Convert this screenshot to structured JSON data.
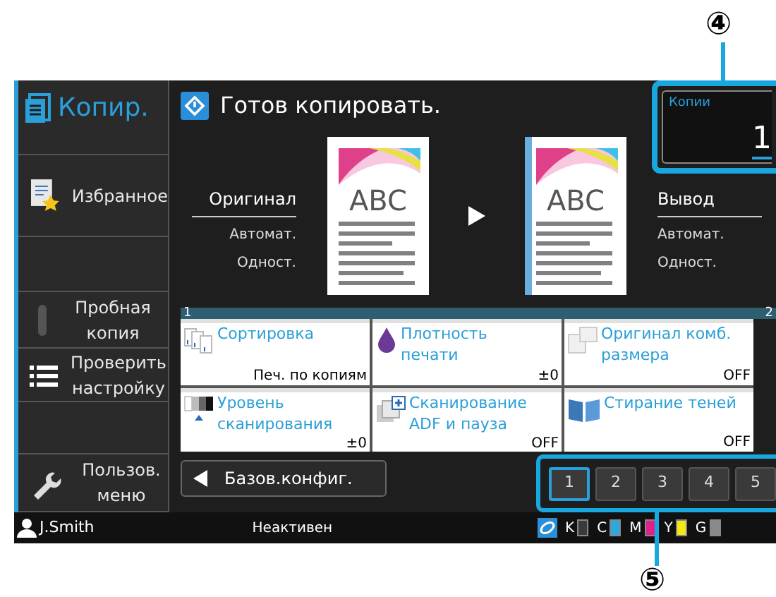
{
  "callouts": [
    {
      "number": "④"
    },
    {
      "number": "⑤"
    }
  ],
  "sidebar": {
    "items": [
      {
        "kind": "mode",
        "label": "Копир.",
        "selected": true
      },
      {
        "kind": "favorites",
        "label": "Избранное",
        "selected": false
      },
      {
        "kind": "blank"
      },
      {
        "kind": "toggle",
        "label": "Пробная копия",
        "on": false
      },
      {
        "kind": "check",
        "label": "Проверить настройку",
        "selected": false
      },
      {
        "kind": "blank"
      },
      {
        "kind": "tools",
        "label": "Пользов. меню",
        "selected": false
      }
    ]
  },
  "status": {
    "message": "Готов копировать."
  },
  "copies": {
    "label": "Копии",
    "value": "1"
  },
  "original": {
    "heading": "Оригинал",
    "lines": [
      "Автомат.",
      "Одност."
    ],
    "preview_text": "ABC"
  },
  "output": {
    "heading": "Вывод",
    "lines": [
      "Автомат.",
      "Одност."
    ],
    "preview_text": "ABC"
  },
  "tile_pages": [
    "1",
    "2"
  ],
  "tile_rows": [
    {
      "tiles": [
        {
          "label": "Сортировка",
          "value": "Печ. по копиям"
        },
        {
          "label": "Плотность печати",
          "value": "±0"
        },
        {
          "label": "Оригинал комб. размера",
          "value": "OFF"
        }
      ]
    },
    {
      "tiles": [
        {
          "label": "Уровень сканирования",
          "value": "±0"
        },
        {
          "label": "Сканирование ADF и пауза",
          "value": "OFF"
        },
        {
          "label": "Стирание теней",
          "value": "OFF"
        }
      ]
    }
  ],
  "back_button": {
    "label": "Базов.конфиг."
  },
  "pages": [
    {
      "label": "1",
      "selected": true
    },
    {
      "label": "2",
      "selected": false
    },
    {
      "label": "3",
      "selected": false
    },
    {
      "label": "4",
      "selected": false
    },
    {
      "label": "5",
      "selected": false
    }
  ],
  "status_bar": {
    "user": "J.Smith",
    "state": "Неактивен",
    "inks": [
      {
        "label": "K",
        "color": "#3a3a3a"
      },
      {
        "label": "C",
        "color": "#29abe2"
      },
      {
        "label": "M",
        "color": "#e0218a"
      },
      {
        "label": "Y",
        "color": "#f5e614"
      },
      {
        "label": "G",
        "color": "#8a8a8a"
      }
    ]
  }
}
